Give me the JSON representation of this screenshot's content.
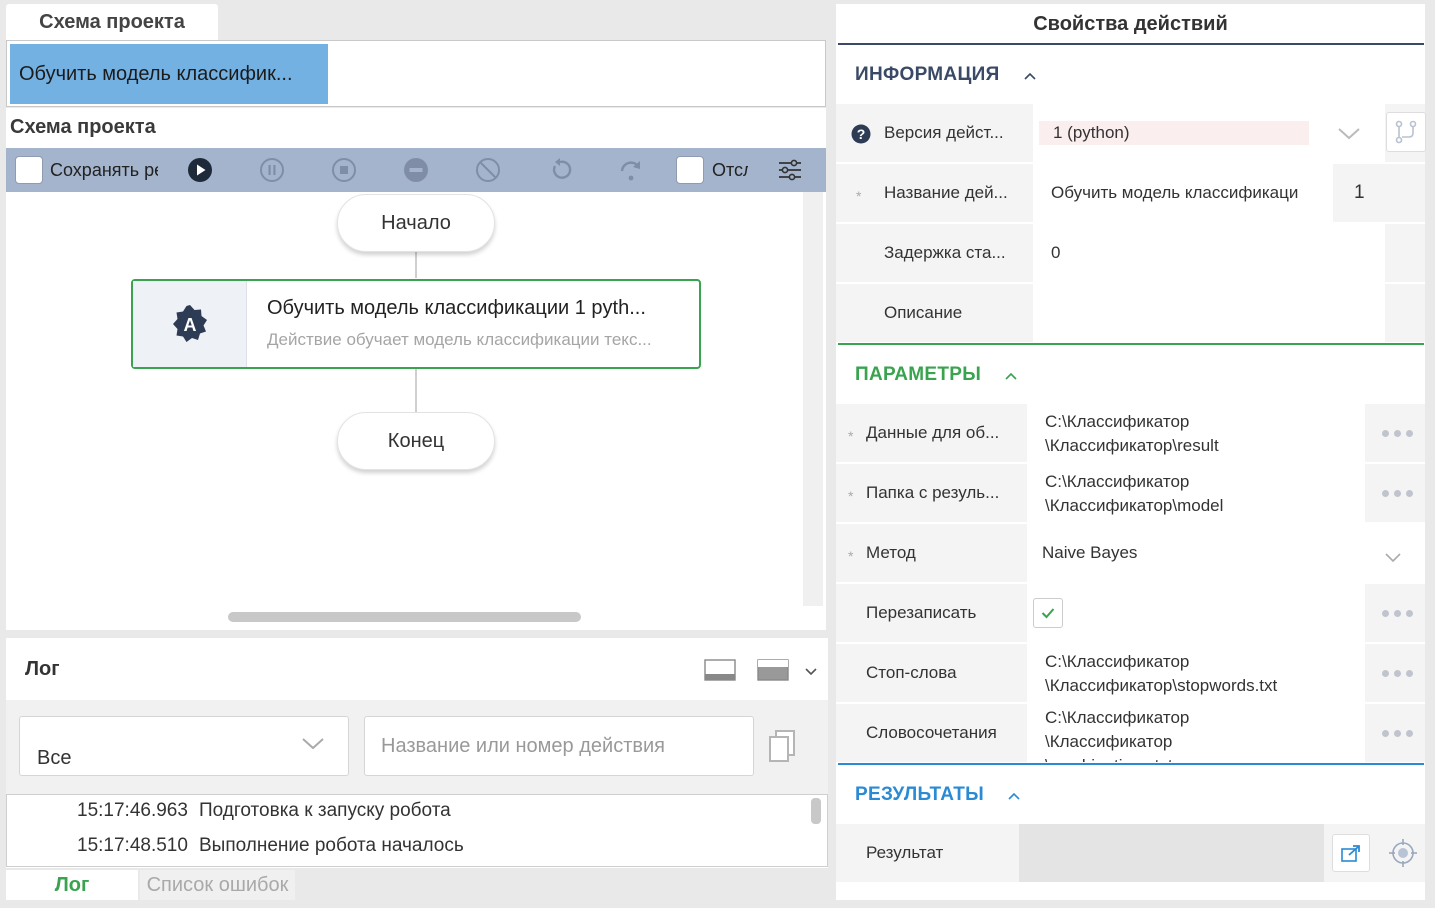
{
  "left": {
    "tab_title": "Схема проекта",
    "breadcrumb_item": "Обучить модель классифик...",
    "schema_title": "Схема проекта",
    "toolbar": {
      "save_label": "Сохранять ре",
      "track_label": "Отсл"
    },
    "flow": {
      "start_label": "Начало",
      "end_label": "Конец",
      "node": {
        "badge": "A",
        "title": "Обучить модель классификации  1  pyth...",
        "description": "Действие обучает модель классификации текс..."
      }
    }
  },
  "log": {
    "title": "Лог",
    "filter_value": "Все",
    "search_placeholder": "Название или номер действия",
    "entries": [
      {
        "time": "15:17:46.963",
        "message": "Подготовка к запуску робота"
      },
      {
        "time": "15:17:48.510",
        "message": "Выполнение робота началось"
      }
    ],
    "tabs": {
      "log": "Лог",
      "errors": "Список ошибок"
    }
  },
  "right": {
    "title": "Свойства действий",
    "sections": {
      "info": "ИНФОРМАЦИЯ",
      "params": "ПАРАМЕТРЫ",
      "results": "РЕЗУЛЬТАТЫ"
    },
    "info": {
      "version_label": "Версия дейст...",
      "version_value": "1 (python)",
      "name_label": "Название дей...",
      "name_value": "Обучить модель классификаци",
      "name_suffix": "1",
      "delay_label": "Задержка ста...",
      "delay_value": "0",
      "desc_label": "Описание"
    },
    "params": {
      "data_label": "Данные для об...",
      "data_value": "C:\\Классификатор\n\\Классификатор\\result",
      "folder_label": "Папка с резуль...",
      "folder_value": "C:\\Классификатор\n\\Классификатор\\model",
      "method_label": "Метод",
      "method_value": "Naive Bayes",
      "overwrite_label": "Перезаписать",
      "stopwords_label": "Стоп-слова",
      "stopwords_value": "C:\\Классификатор\n\\Классификатор\\stopwords.txt",
      "phrases_label": "Словосочетания",
      "phrases_value": "C:\\Классификатор\n\\Классификатор\n\\combinations.txt"
    },
    "results": {
      "result_label": "Результат"
    }
  },
  "colors": {
    "accent_green": "#3aa34f",
    "accent_blue": "#2a8ad4",
    "toolbar_bg": "#a3b4cc",
    "breadcrumb_bg": "#74b1e3"
  }
}
